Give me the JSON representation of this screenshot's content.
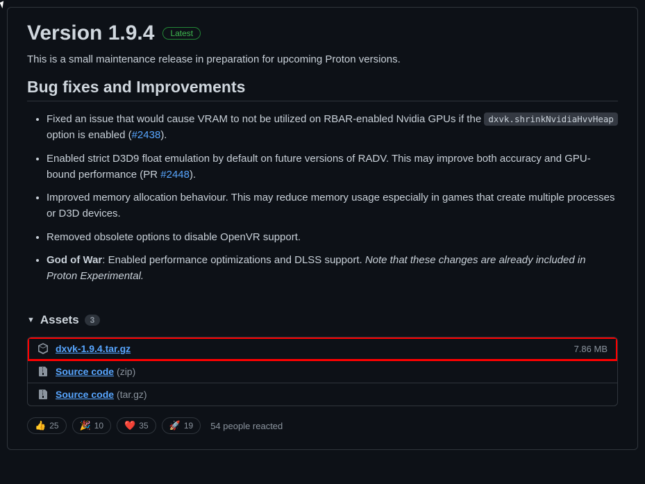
{
  "release": {
    "title": "Version 1.9.4",
    "latest_label": "Latest",
    "description": "This is a small maintenance release in preparation for upcoming Proton versions."
  },
  "section": {
    "bugfixes_title": "Bug fixes and Improvements"
  },
  "bugfixes": {
    "item0": {
      "pre": "Fixed an issue that would cause VRAM to not be utilized on RBAR-enabled Nvidia GPUs if the ",
      "code": "dxvk.shrinkNvidiaHvvHeap",
      "mid": " option is enabled (",
      "link": "#2438",
      "post": ")."
    },
    "item1": {
      "pre": "Enabled strict D3D9 float emulation by default on future versions of RADV. This may improve both accuracy and GPU-bound performance (PR ",
      "link": "#2448",
      "post": ")."
    },
    "item2": {
      "text": "Improved memory allocation behaviour. This may reduce memory usage especially in games that create multiple processes or D3D devices."
    },
    "item3": {
      "text": "Removed obsolete options to disable OpenVR support."
    },
    "item4": {
      "bold": "God of War",
      "normal": ": Enabled performance optimizations and DLSS support. ",
      "italic": "Note that these changes are already included in Proton Experimental."
    }
  },
  "assets": {
    "label": "Assets",
    "count": "3",
    "items": [
      {
        "name": "dxvk-1.9.4.tar.gz",
        "suffix": "",
        "size": "7.86 MB",
        "icon": "package"
      },
      {
        "name": "Source code",
        "suffix": "(zip)",
        "size": "",
        "icon": "zip"
      },
      {
        "name": "Source code",
        "suffix": "(tar.gz)",
        "size": "",
        "icon": "zip"
      }
    ]
  },
  "reactions": {
    "items": [
      {
        "emoji": "👍",
        "count": "25"
      },
      {
        "emoji": "🎉",
        "count": "10"
      },
      {
        "emoji": "❤️",
        "count": "35"
      },
      {
        "emoji": "🚀",
        "count": "19"
      }
    ],
    "summary": "54 people reacted"
  }
}
